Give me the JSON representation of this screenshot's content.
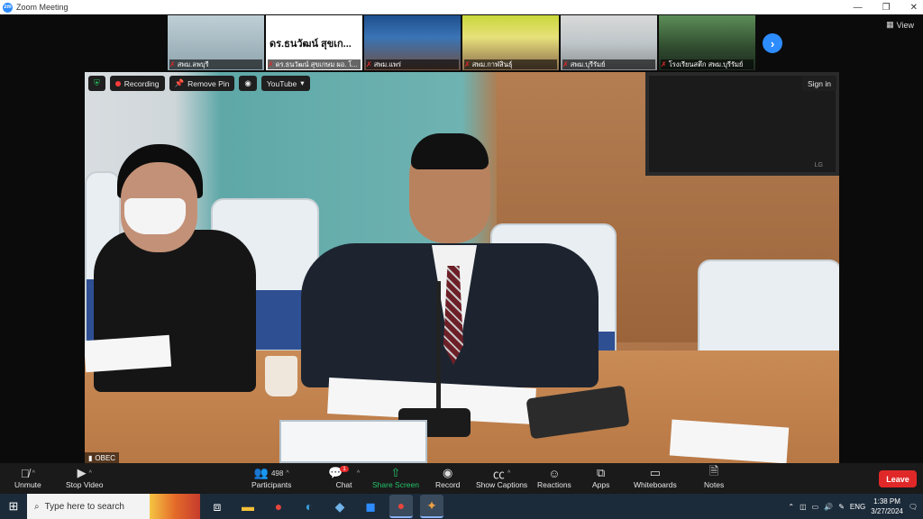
{
  "window": {
    "title": "Zoom Meeting",
    "logo_text": "zm",
    "minimize": "—",
    "maximize": "❐",
    "close": "✕"
  },
  "view": {
    "label": "View"
  },
  "thumbnails": [
    {
      "name": "สพม.ลพบุรี"
    },
    {
      "name": "ดร.ธนวัฒน์ สุขเกษม ผอ. โ...",
      "big_name": "ดร.ธนวัฒน์ สุขเก..."
    },
    {
      "name": "สพม.แพร่"
    },
    {
      "name": "สพม.กาฬสินธุ์"
    },
    {
      "name": "สพม.บุรีรัมย์"
    },
    {
      "name": "โรงเรียนสตึก สพม.บุรีรัมย์"
    }
  ],
  "video_controls": {
    "recording": "Recording",
    "remove_pin": "Remove Pin",
    "youtube": "YouTube",
    "sign_in": "Sign in"
  },
  "speaker": {
    "name": "OBEC"
  },
  "tv_brand": "LG",
  "toolbar": {
    "unmute": "Unmute",
    "stop_video": "Stop Video",
    "participants": "Participants",
    "participants_count": "498",
    "chat": "Chat",
    "chat_badge": "1",
    "share_screen": "Share Screen",
    "record": "Record",
    "show_captions": "Show Captions",
    "reactions": "Reactions",
    "apps": "Apps",
    "whiteboards": "Whiteboards",
    "notes": "Notes",
    "leave": "Leave"
  },
  "taskbar": {
    "search_placeholder": "Type here to search",
    "language": "ENG",
    "time": "1:38 PM",
    "date": "3/27/2024"
  },
  "colors": {
    "accent": "#2d8cff",
    "leave": "#e02828",
    "share": "#25c36b"
  }
}
